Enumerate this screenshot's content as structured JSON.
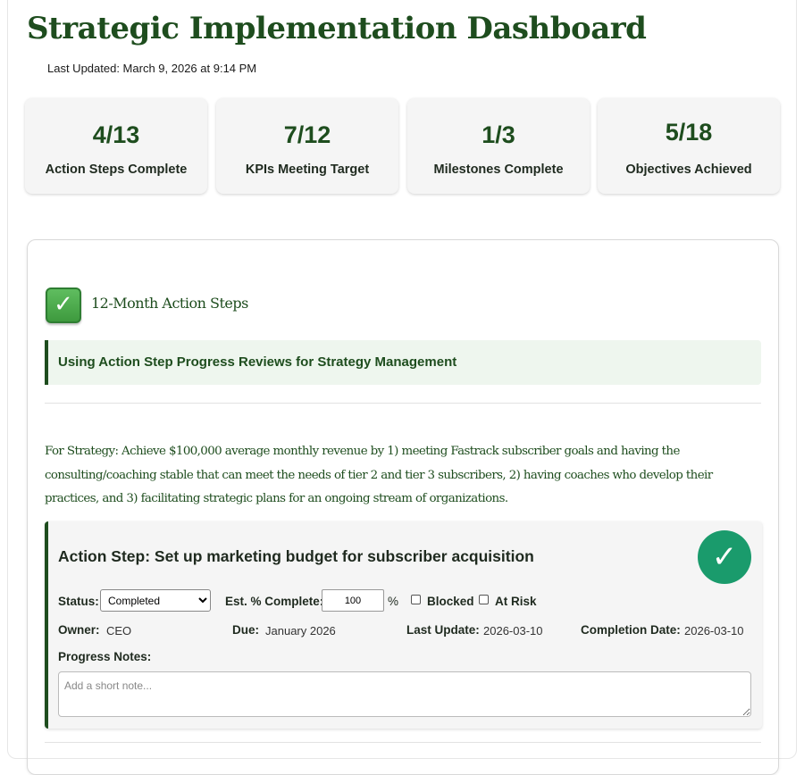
{
  "header": {
    "title": "Strategic Implementation Dashboard",
    "last_updated": "Last Updated: March 9, 2026 at 9:14 PM"
  },
  "stats": [
    {
      "value": "4/13",
      "label": "Action Steps Complete"
    },
    {
      "value": "7/12",
      "label": "KPIs Meeting Target"
    },
    {
      "value": "1/3",
      "label": "Milestones Complete"
    },
    {
      "value": "5/18",
      "label": "Objectives Achieved"
    }
  ],
  "section": {
    "icon": "check-box-icon",
    "title": "12-Month Action Steps",
    "callout": "Using Action Step Progress Reviews for Strategy Management",
    "strategy_text": "For Strategy: Achieve $100,000 average monthly revenue by 1) meeting Fastrack subscriber goals and having the consulting/coaching stable that can meet the needs of tier 2 and tier 3 subscribers, 2) having coaches who develop their practices, and 3) facilitating strategic plans for an ongoing stream of organizations."
  },
  "action_step": {
    "title": "Action Step: Set up marketing budget for subscriber acquisition",
    "badge_icon": "checkmark-icon",
    "badge_color": "#1a9b6c",
    "status_label": "Status:",
    "status_value": "Completed",
    "status_options": [
      "Completed"
    ],
    "pct_label": "Est. % Complete:",
    "pct_value": "100",
    "pct_unit": "%",
    "blocked_label": "Blocked",
    "blocked_checked": false,
    "at_risk_label": "At Risk",
    "at_risk_checked": false,
    "owner_label": "Owner:",
    "owner_value": "CEO",
    "due_label": "Due:",
    "due_value": "January 2026",
    "last_update_label": "Last Update:",
    "last_update_value": "2026-03-10",
    "completion_label": "Completion Date:",
    "completion_value": "2026-03-10",
    "notes_label": "Progress Notes:",
    "notes_placeholder": "Add a short note...",
    "notes_value": ""
  },
  "colors": {
    "accent": "#1e4d1e",
    "callout_bg": "#eef6ee",
    "card_bg": "#f5f5f5"
  }
}
